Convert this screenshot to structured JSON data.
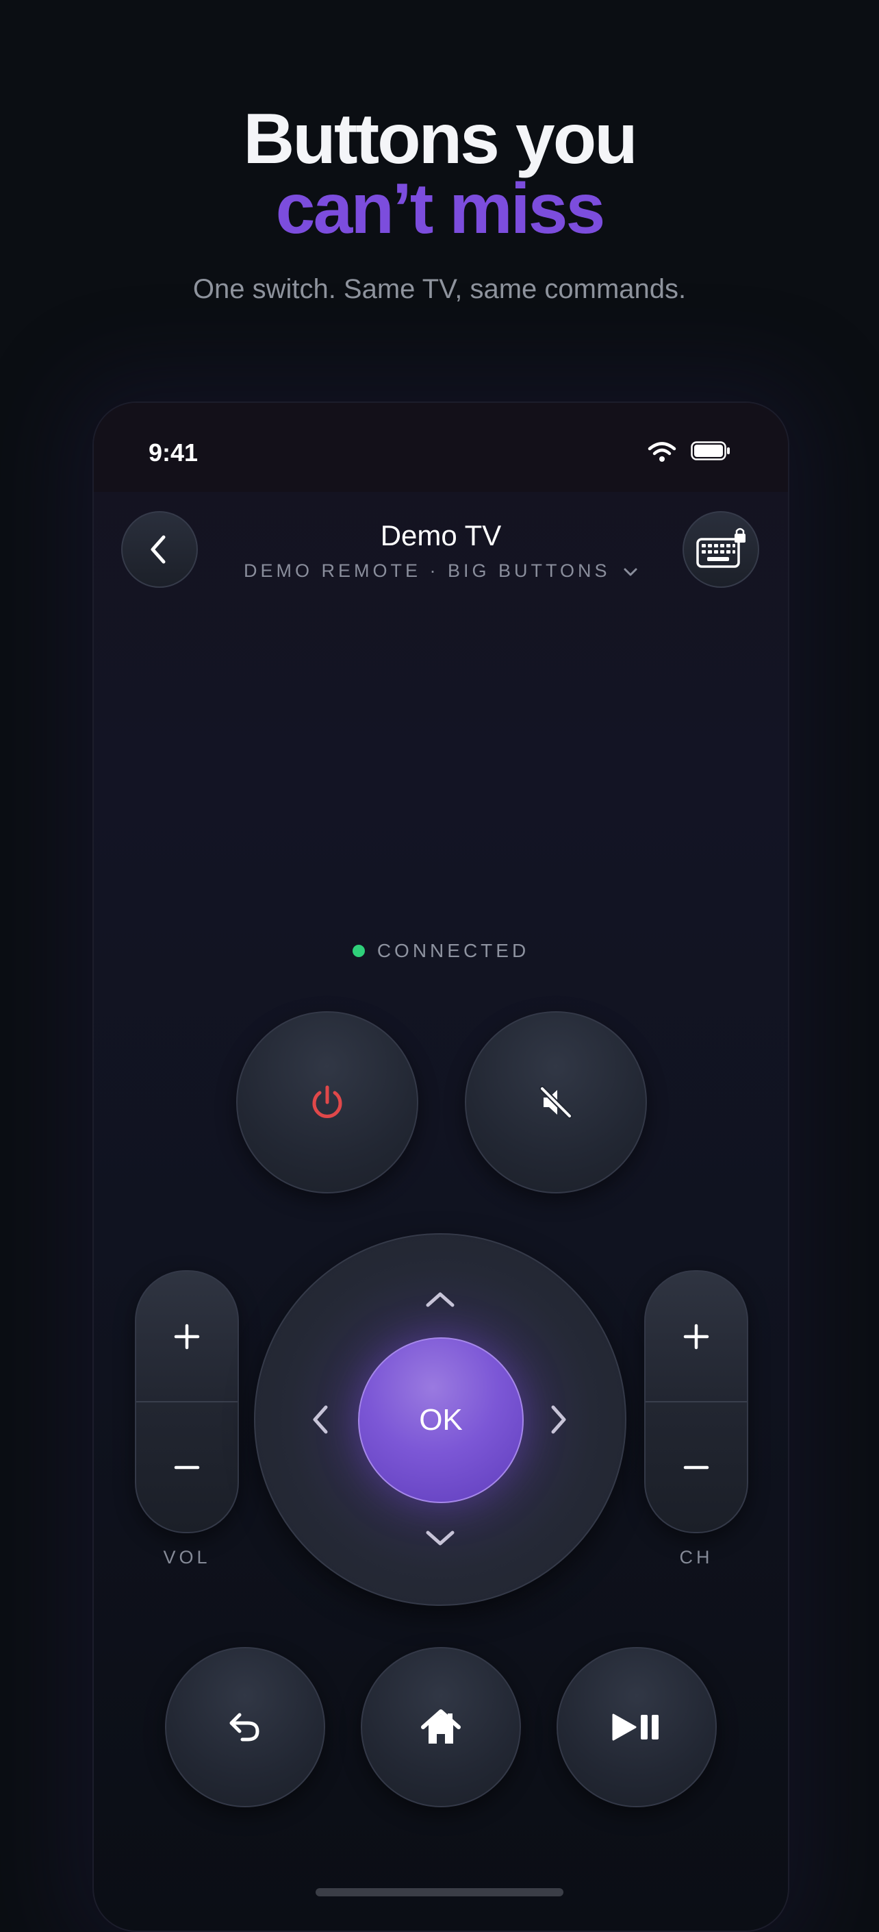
{
  "hero": {
    "title_line1": "Buttons you",
    "title_line2": "can’t miss",
    "subtitle": "One switch. Same TV, same commands."
  },
  "status_bar": {
    "time": "9:41",
    "icons": [
      "wifi-icon",
      "battery-icon"
    ]
  },
  "header": {
    "back_icon": "chevron-left-icon",
    "device_name": "Demo TV",
    "device_subtitle": "DEMO REMOTE · BIG BUTTONS",
    "keyboard_icon": "keyboard-lock-icon"
  },
  "connection": {
    "status": "CONNECTED",
    "color": "#2fd07a"
  },
  "remote": {
    "power_icon": "power-icon",
    "power_color": "#e0484a",
    "mute_icon": "mute-icon",
    "ok_label": "OK",
    "accent": "#7c4ddd",
    "vol_label": "VOL",
    "ch_label": "CH",
    "plus": "+",
    "minus": "−",
    "nav_icons": [
      "back-arrow-icon",
      "home-icon",
      "play-pause-icon"
    ]
  }
}
